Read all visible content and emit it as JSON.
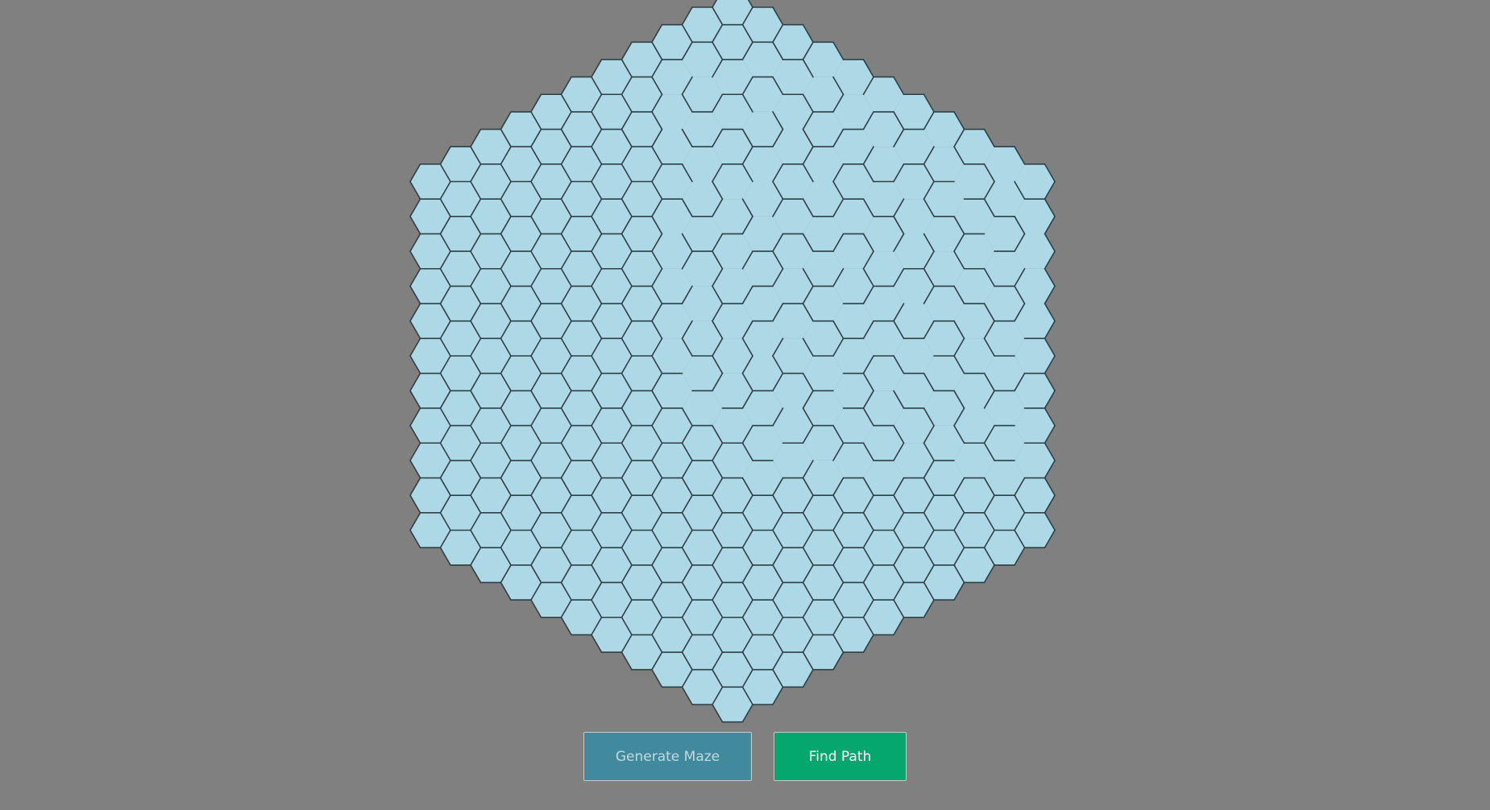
{
  "maze": {
    "radius": 10,
    "colors": {
      "background": "#808080",
      "cell_fill": "#add8e6",
      "wall": "#2f3f45"
    }
  },
  "controls": {
    "generate_label": "Generate Maze",
    "find_path_label": "Find Path"
  }
}
